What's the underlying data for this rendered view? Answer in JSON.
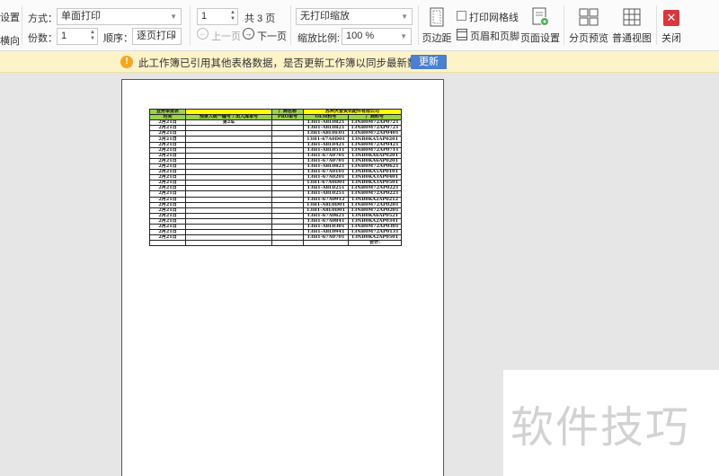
{
  "toolbar": {
    "left_partial_top": "设置",
    "left_partial_bottom": "横向",
    "mode_label": "方式：",
    "mode_value": "单面打印",
    "copies_label": "份数：",
    "copies_value": "1",
    "order_label": "顺序：",
    "order_value": "逐页打印",
    "page_value": "1",
    "total_pages": "共 3 页",
    "prev_page": "上一页",
    "next_page": "下一页",
    "scale_mode": "无打印缩放",
    "zoom_label": "缩放比例:",
    "zoom_value": "100 %",
    "margins": "页边距",
    "print_gridlines": "打印网格线",
    "header_footer": "页眉和页脚",
    "page_setup": "页面设置",
    "page_break_preview": "分页预览",
    "normal_view": "普通视图",
    "close": "关闭"
  },
  "notification": {
    "message": "此工作簿已引用其他表格数据，是否更新工作簿以同步最新数据？",
    "update_button": "更新"
  },
  "sheet": {
    "title1": "业务审批表",
    "vendor_label": "厂商名称",
    "vendor_name": "苏州大智资讯配件有限公司",
    "headers": [
      "时间",
      "预录入统一编号 / 出入库单号",
      "PRO单号",
      "OEM料号",
      "厂商料号"
    ],
    "first_note": "第2车",
    "total_label": "合计:",
    "rows": [
      [
        "2月21日",
        "13H1-A8L0821",
        "13NB0M72AP0721"
      ],
      [
        "2月21日",
        "13H1-A8L0821",
        "13NB0M72AP0721"
      ],
      [
        "2月21日",
        "13H1-A8L0E01",
        "13NB0M72AP0401"
      ],
      [
        "2月21日",
        "13H1-67A0D01",
        "13NB0KA5AP0201"
      ],
      [
        "2月21日",
        "13H1-A8L0421",
        "13NB0M72AP0421"
      ],
      [
        "2月21日",
        "13H1-A8L0511",
        "13NB0M72AP0711"
      ],
      [
        "2月21日",
        "13H1-67A0701",
        "13NB0KA6AP0201"
      ],
      [
        "2月21日",
        "13H1-67A0701",
        "13NB0KA6AP0201"
      ],
      [
        "2月21日",
        "13H1-A8L0821",
        "13NB0M72AP0621"
      ],
      [
        "2月21日",
        "13H1-67A0101",
        "13NB0KA5AP0101"
      ],
      [
        "2月21日",
        "13H1-67A0201",
        "13NB0KA3AP0401"
      ],
      [
        "2月21日",
        "13H1-67A0D01",
        "13NB0KA3AP0501"
      ],
      [
        "2月21日",
        "13H1-A8L0251",
        "13NB0M72AP0221"
      ],
      [
        "2月21日",
        "13H1-A8L0251",
        "13NB0M72AP0221"
      ],
      [
        "2月21日",
        "13H1-67A0912",
        "13NB0KA2AP0212"
      ],
      [
        "2月21日",
        "13H1-A8L0D01",
        "13NB0M72AP0201"
      ],
      [
        "2月21日",
        "13H1-A8L0D01",
        "13NB0M72AP0201"
      ],
      [
        "2月21日",
        "13H1-67A0621",
        "13NB0KA6AP0521"
      ],
      [
        "2月21日",
        "13H1-67A0841",
        "13NB0KA2AP0341"
      ],
      [
        "2月21日",
        "13H1-A8L0301",
        "13NB0M72AP0301"
      ],
      [
        "2月21日",
        "13H1-A8L0941",
        "13NB0M72AP0131"
      ],
      [
        "2月21日",
        "13H1-67A0701",
        "13NB0KA2AP0501"
      ]
    ]
  },
  "watermark": "软件技巧",
  "colors": {
    "header_green": "#9ad24a",
    "header_yellow": "#ffff00",
    "update_button": "#4a7fd1",
    "notify_bg": "#fdf3c8",
    "close_red": "#d9363e"
  }
}
